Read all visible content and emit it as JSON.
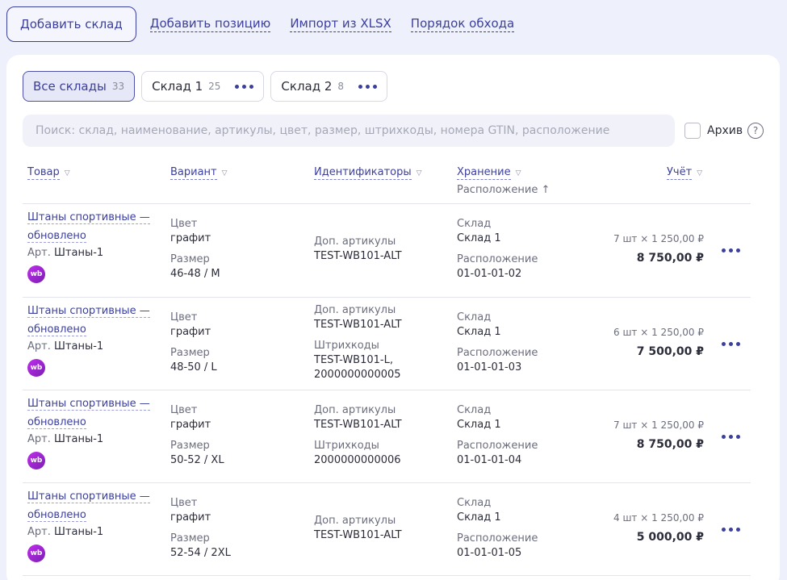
{
  "toolbar": {
    "add_warehouse": "Добавить склад",
    "add_item": "Добавить позицию",
    "import": "Импорт из XLSX",
    "walk_order": "Порядок обхода"
  },
  "tabs": [
    {
      "label": "Все склады",
      "count": "33"
    },
    {
      "label": "Склад 1",
      "count": "25"
    },
    {
      "label": "Склад 2",
      "count": "8"
    }
  ],
  "search": {
    "placeholder": "Поиск: склад, наименование, артикулы, цвет, размер, штрихкоды, номера GTIN, расположение"
  },
  "archive": {
    "label": "Архив",
    "help": "?"
  },
  "columns": {
    "product": "Товар",
    "variant": "Вариант",
    "ids": "Идентификаторы",
    "storage": "Хранение",
    "storage_sort": "Расположение ↑",
    "account": "Учёт"
  },
  "labels": {
    "color": "Цвет",
    "size": "Размер",
    "extra_sku": "Доп. артикулы",
    "barcodes": "Штрихкоды",
    "warehouse": "Склад",
    "location": "Расположение",
    "art_prefix": "Арт.",
    "wb_badge": "wb"
  },
  "rows": [
    {
      "name_line1": "Штаны спортивные —",
      "name_line2": "обновлено",
      "art": "Штаны-1",
      "color": "графит",
      "size": "46-48 / M",
      "extra_sku": "TEST-WB101-ALT",
      "barcodes": "",
      "warehouse": "Склад 1",
      "location": "01-01-01-02",
      "qty": "7 шт",
      "price": "1 250,00 ₽",
      "total": "8 750,00 ₽"
    },
    {
      "name_line1": "Штаны спортивные —",
      "name_line2": "обновлено",
      "art": "Штаны-1",
      "color": "графит",
      "size": "48-50 / L",
      "extra_sku": "TEST-WB101-ALT",
      "barcodes_line1": "TEST-WB101-L,",
      "barcodes_line2": "2000000000005",
      "warehouse": "Склад 1",
      "location": "01-01-01-03",
      "qty": "6 шт",
      "price": "1 250,00 ₽",
      "total": "7 500,00 ₽"
    },
    {
      "name_line1": "Штаны спортивные —",
      "name_line2": "обновлено",
      "art": "Штаны-1",
      "color": "графит",
      "size": "50-52 / XL",
      "extra_sku": "TEST-WB101-ALT",
      "barcodes_line1": "2000000000006",
      "warehouse": "Склад 1",
      "location": "01-01-01-04",
      "qty": "7 шт",
      "price": "1 250,00 ₽",
      "total": "8 750,00 ₽"
    },
    {
      "name_line1": "Штаны спортивные —",
      "name_line2": "обновлено",
      "art": "Штаны-1",
      "color": "графит",
      "size": "52-54 / 2XL",
      "extra_sku": "TEST-WB101-ALT",
      "barcodes": "",
      "warehouse": "Склад 1",
      "location": "01-01-01-05",
      "qty": "4 шт",
      "price": "1 250,00 ₽",
      "total": "5 000,00 ₽"
    }
  ]
}
